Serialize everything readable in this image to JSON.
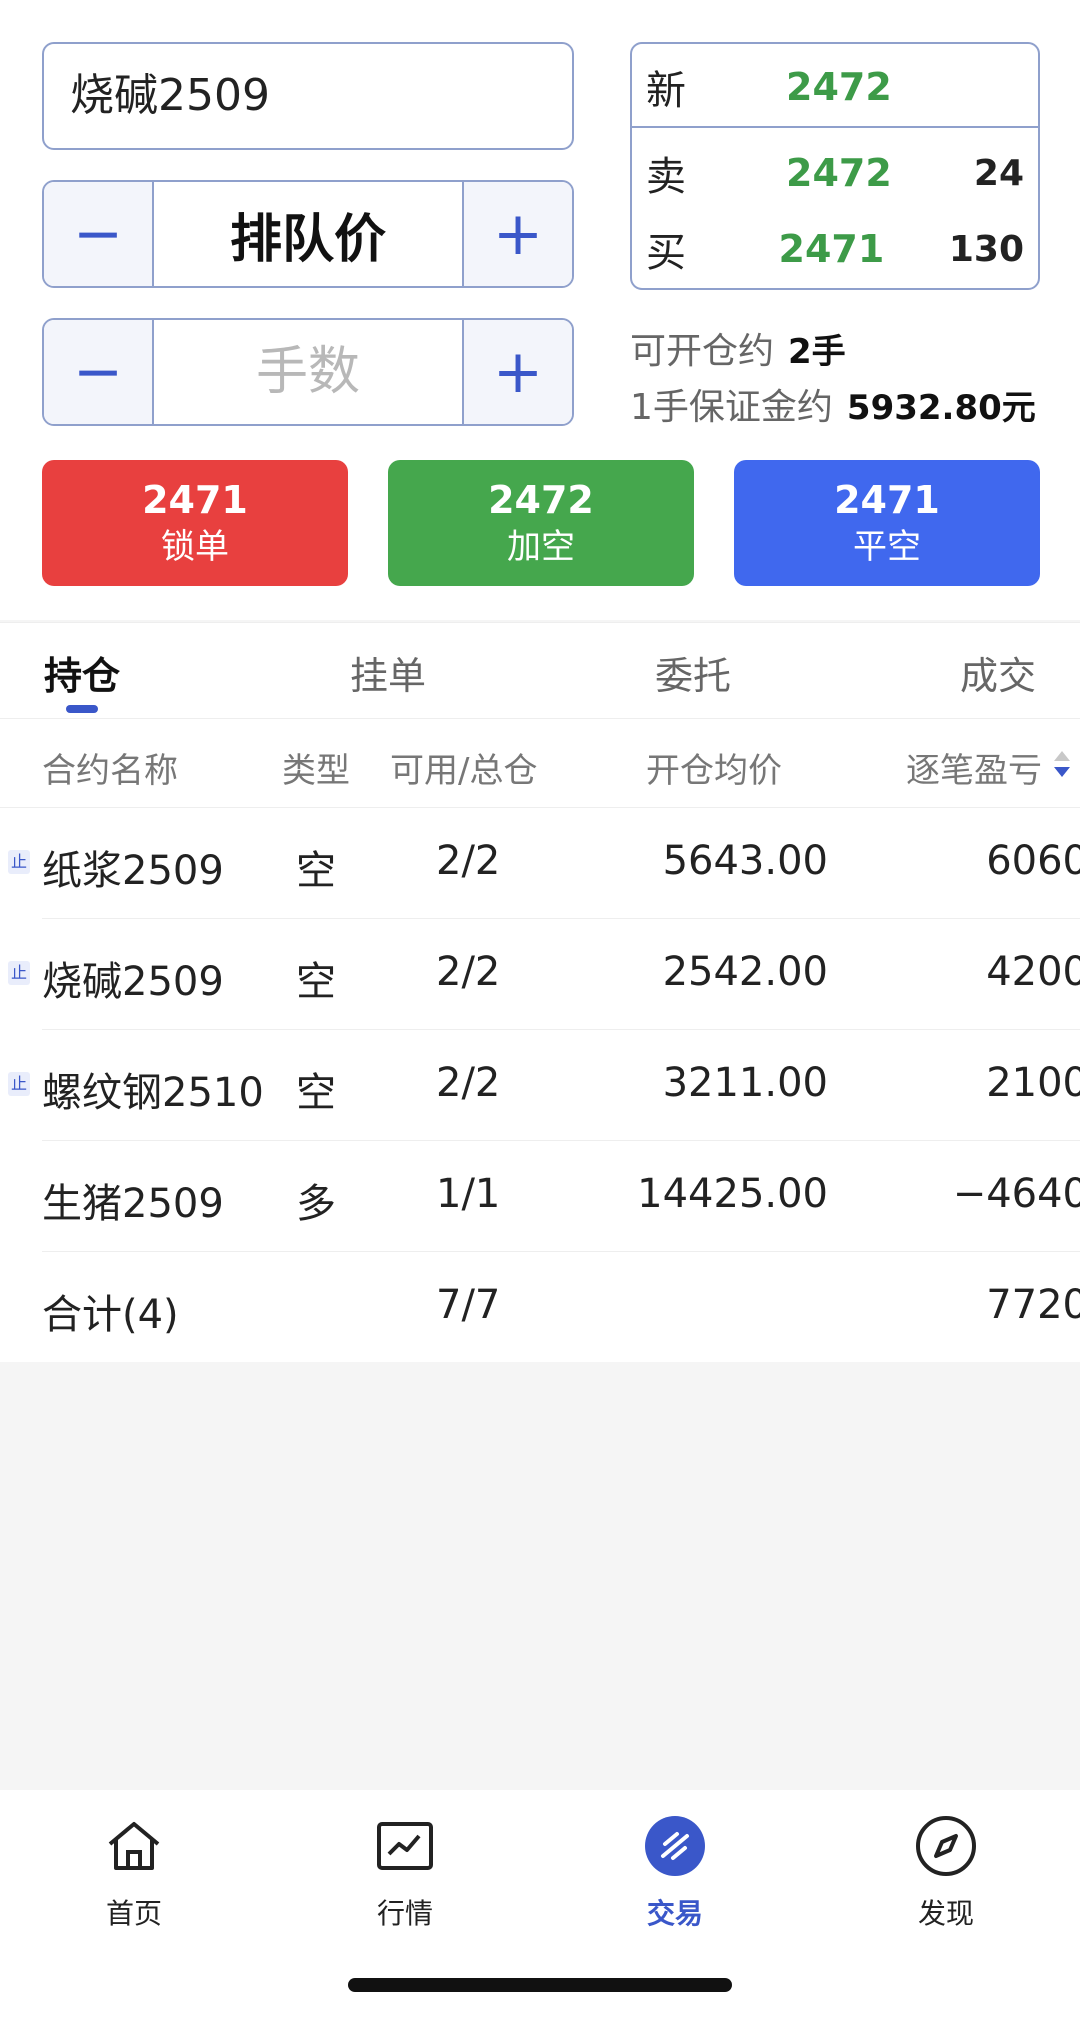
{
  "order": {
    "contract": "烧碱2509",
    "price_mode": "排队价",
    "qty_placeholder": "手数",
    "minus": "−",
    "plus": "+"
  },
  "quote": {
    "new": {
      "label": "新",
      "price": "2472"
    },
    "sell": {
      "label": "卖",
      "price": "2472",
      "volume": "24"
    },
    "buy": {
      "label": "买",
      "price": "2471",
      "volume": "130"
    }
  },
  "info": {
    "open_label": "可开仓约",
    "open_value": "2手",
    "margin_label": "1手保证金约",
    "margin_value": "5932.80元"
  },
  "actions": [
    {
      "price": "2471",
      "label": "锁单",
      "color": "#e8403f"
    },
    {
      "price": "2472",
      "label": "加空",
      "color": "#45a74d"
    },
    {
      "price": "2471",
      "label": "平空",
      "color": "#4068ee"
    }
  ],
  "tabs": [
    {
      "label": "持仓",
      "active": true
    },
    {
      "label": "挂单",
      "active": false
    },
    {
      "label": "委托",
      "active": false
    },
    {
      "label": "成交",
      "active": false
    }
  ],
  "table": {
    "headers": [
      "合约名称",
      "类型",
      "可用/总仓",
      "开仓均价",
      "逐笔盈亏"
    ],
    "stop_tag": "止",
    "rows": [
      {
        "name": "纸浆2509",
        "type": "空",
        "position": "2/2",
        "avg_price": "5643.00",
        "pnl": "6060",
        "stop": true
      },
      {
        "name": "烧碱2509",
        "type": "空",
        "position": "2/2",
        "avg_price": "2542.00",
        "pnl": "4200",
        "stop": true
      },
      {
        "name": "螺纹钢2510",
        "type": "空",
        "position": "2/2",
        "avg_price": "3211.00",
        "pnl": "2100",
        "stop": true
      },
      {
        "name": "生猪2509",
        "type": "多",
        "position": "1/1",
        "avg_price": "14425.00",
        "pnl": "−4640",
        "stop": false
      }
    ],
    "total": {
      "label": "合计(4)",
      "position": "7/7",
      "pnl": "7720"
    }
  },
  "nav": [
    {
      "label": "首页",
      "icon": "home-icon",
      "active": false
    },
    {
      "label": "行情",
      "icon": "chart-icon",
      "active": false
    },
    {
      "label": "交易",
      "icon": "trade-icon",
      "active": true
    },
    {
      "label": "发现",
      "icon": "compass-icon",
      "active": false
    }
  ],
  "colors": {
    "accent": "#3a57c9",
    "up": "#e8403f",
    "down": "#3d9b48"
  }
}
